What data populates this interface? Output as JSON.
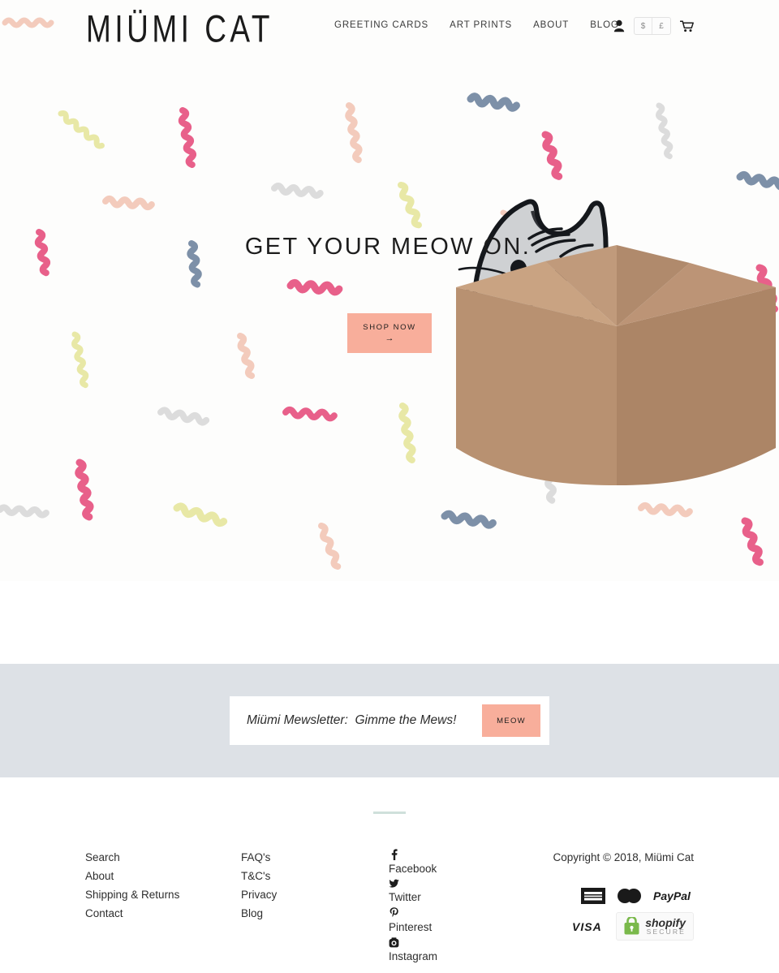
{
  "site": {
    "logo": "MIÜMI CAT",
    "accent_peach": "#f8ae9b",
    "band_grey": "#dde1e6",
    "divider_mint": "#cfe0db"
  },
  "header": {
    "nav": [
      {
        "label": "GREETING CARDS"
      },
      {
        "label": "ART PRINTS"
      },
      {
        "label": "ABOUT"
      },
      {
        "label": "BLOG"
      }
    ],
    "account_icon": "user-icon",
    "cart_icon": "shopping-cart-icon",
    "currency": {
      "options": [
        "$",
        "£"
      ],
      "usd": "$",
      "gbp": "£"
    }
  },
  "hero": {
    "title": "GET YOUR MEOW ON.",
    "cta_label": "SHOP NOW",
    "cta_arrow": "→",
    "illustration": "cat-in-box-illustration"
  },
  "newsletter": {
    "placeholder": "Miümi Mewsletter:  Gimme the Mews!",
    "value": "",
    "button_label": "MEOW"
  },
  "footer": {
    "links_col1": [
      {
        "label": "Search"
      },
      {
        "label": "About"
      },
      {
        "label": "Shipping & Returns"
      },
      {
        "label": "Contact"
      }
    ],
    "links_col2": [
      {
        "label": "FAQ's"
      },
      {
        "label": "T&C's"
      },
      {
        "label": "Privacy"
      },
      {
        "label": "Blog"
      }
    ],
    "social": [
      {
        "label": "Facebook",
        "icon": "facebook-icon"
      },
      {
        "label": "Twitter",
        "icon": "twitter-icon"
      },
      {
        "label": "Pinterest",
        "icon": "pinterest-icon"
      },
      {
        "label": "Instagram",
        "icon": "instagram-icon"
      }
    ],
    "copyright": "Copyright © 2018, Miümi Cat",
    "payment_icons": [
      {
        "label": "American Express"
      },
      {
        "label": "MasterCard"
      },
      {
        "label": "PayPal"
      },
      {
        "label": "VISA"
      }
    ],
    "security_badge": {
      "brand": "shopify",
      "sub": "SECURE"
    }
  },
  "decor": {
    "colors": {
      "pink": "#e8608a",
      "yellow": "#e8e8a6",
      "peach": "#f3cbbc",
      "blue": "#7d90a8",
      "grey": "#dcdcdc"
    }
  }
}
